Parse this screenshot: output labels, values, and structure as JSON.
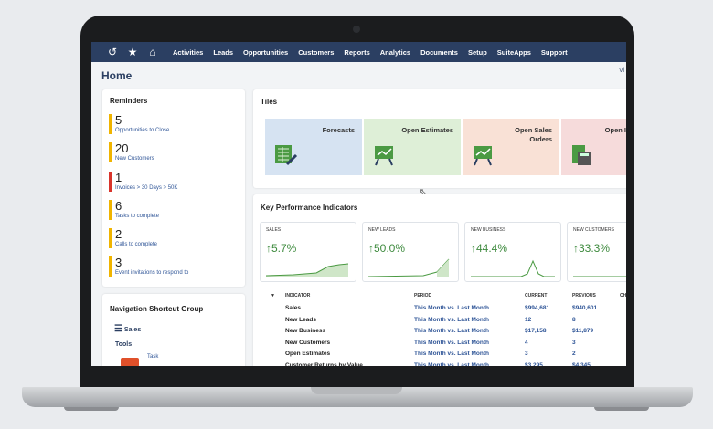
{
  "nav": {
    "items": [
      "Activities",
      "Leads",
      "Opportunities",
      "Customers",
      "Reports",
      "Analytics",
      "Documents",
      "Setup",
      "SuiteApps",
      "Support"
    ]
  },
  "page": {
    "title": "Home",
    "view_link": "Vi"
  },
  "reminders": {
    "title": "Reminders",
    "items": [
      {
        "count": "5",
        "label": "Opportunities to Close",
        "color": "#f0b400"
      },
      {
        "count": "20",
        "label": "New Customers",
        "color": "#f0b400"
      },
      {
        "count": "1",
        "label": "Invoices > 30 Days > 50K",
        "color": "#d9342b"
      },
      {
        "count": "6",
        "label": "Tasks to complete",
        "color": "#f0b400"
      },
      {
        "count": "2",
        "label": "Calls to complete",
        "color": "#f0b400"
      },
      {
        "count": "3",
        "label": "Event invitations to respond to",
        "color": "#f0b400"
      }
    ]
  },
  "shortcuts": {
    "title": "Navigation Shortcut Group",
    "group": "Sales",
    "tools_label": "Tools",
    "task_label": "Task"
  },
  "tiles": {
    "title": "Tiles",
    "items": [
      {
        "label": "Forecasts",
        "color": "#d6e3f2"
      },
      {
        "label": "Open Estimates",
        "color": "#deefd7"
      },
      {
        "label": "Open Sales Orders",
        "color": "#f9e1d6"
      },
      {
        "label": "Open I",
        "color": "#f6dbdb"
      }
    ]
  },
  "kpi": {
    "title": "Key Performance Indicators",
    "cards": [
      {
        "label": "SALES",
        "value": "5.7%"
      },
      {
        "label": "NEW LEADS",
        "value": "50.0%"
      },
      {
        "label": "NEW BUSINESS",
        "value": "44.4%"
      },
      {
        "label": "NEW CUSTOMERS",
        "value": "33.3%"
      }
    ],
    "table": {
      "headers": {
        "indicator": "INDICATOR",
        "period": "PERIOD",
        "current": "CURRENT",
        "previous": "PREVIOUS",
        "change": "CH"
      },
      "rows": [
        {
          "indicator": "Sales",
          "period": "This Month vs. Last Month",
          "current": "$994,681",
          "previous": "$940,601"
        },
        {
          "indicator": "New Leads",
          "period": "This Month vs. Last Month",
          "current": "12",
          "previous": "8"
        },
        {
          "indicator": "New Business",
          "period": "This Month vs. Last Month",
          "current": "$17,158",
          "previous": "$11,879"
        },
        {
          "indicator": "New Customers",
          "period": "This Month vs. Last Month",
          "current": "4",
          "previous": "3"
        },
        {
          "indicator": "Open Estimates",
          "period": "This Month vs. Last Month",
          "current": "3",
          "previous": "2"
        },
        {
          "indicator": "Customer Returns by Value",
          "period": "This Month vs. Last Month",
          "current": "$3,295",
          "previous": "$4,345"
        }
      ]
    }
  },
  "colors": {
    "nav": "#2b3f62",
    "accent_green": "#3f8b3f",
    "link": "#2f5597"
  }
}
